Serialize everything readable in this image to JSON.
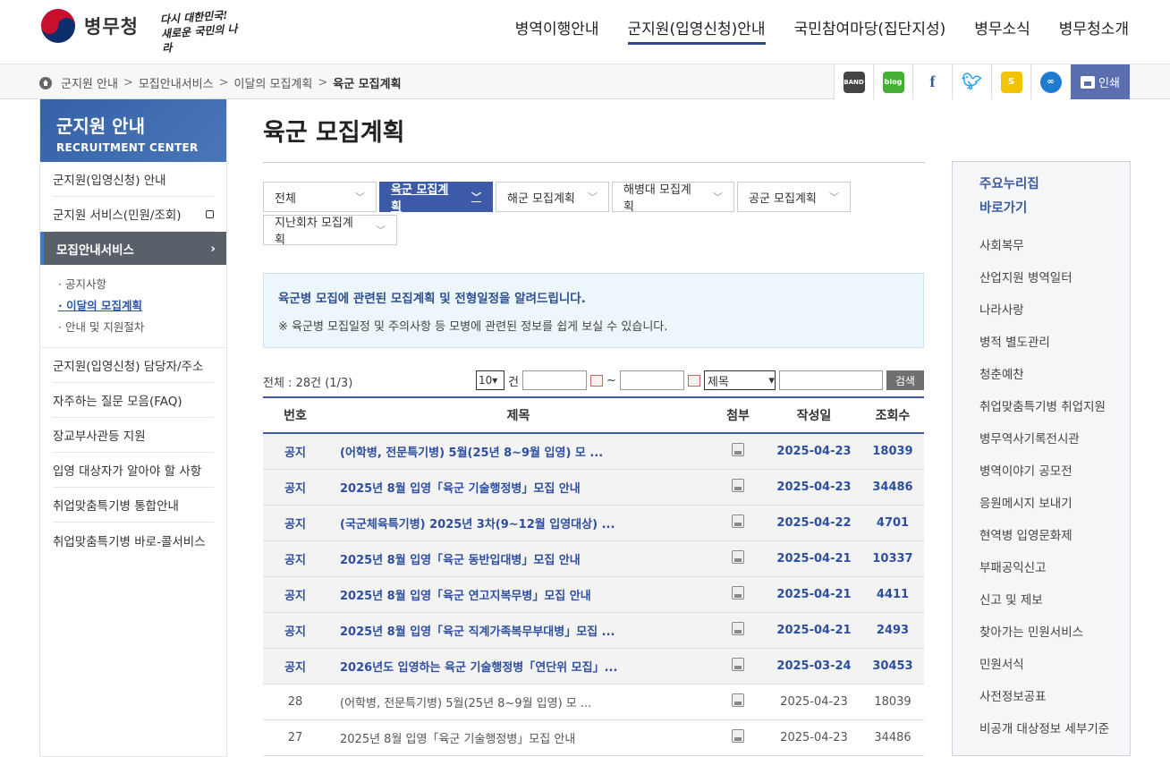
{
  "header": {
    "logo_text": "병무청",
    "slogan": "다시 대한민국! 새로운 국민의 나라",
    "nav": [
      "병역이행안내",
      "군지원(입영신청)안내",
      "국민참여마당(집단지성)",
      "병무소식",
      "병무청소개"
    ]
  },
  "breadcrumb": [
    "군지원 안내",
    "모집안내서비스",
    "이달의 모집계획",
    "육군 모집계획"
  ],
  "share": {
    "band": "BAND",
    "blog": "blog",
    "facebook": "f",
    "twitter": "t",
    "story": "S",
    "link": "∞",
    "print": "인쇄"
  },
  "lnb": {
    "title": "군지원 안내",
    "subtitle": "RECRUITMENT CENTER",
    "items_top": [
      "군지원(입영신청) 안내",
      "군지원 서비스(민원/조회)"
    ],
    "active": "모집안내서비스",
    "sub": [
      "공지사항",
      "이달의 모집계획",
      "안내 및 지원절차"
    ],
    "items_bottom": [
      "군지원(입영신청) 담당자/주소",
      "자주하는 질문 모음(FAQ)",
      "장교부사관등 지원",
      "입영 대상자가 알아야 할 사항",
      "취업맞춤특기병 통합안내",
      "취업맞춤특기병 바로-콜서비스"
    ]
  },
  "main": {
    "title": "육군 모집계획",
    "tabs": [
      "전체",
      "육군 모집계획",
      "해군 모집계획",
      "해병대 모집계획",
      "공군 모집계획",
      "지난회차 모집계획"
    ],
    "info_line1": "육군병 모집에 관련된 모집계획 및 전형일정을 알려드립니다.",
    "info_line2": "※ 육군병 모집일정 및 주의사항 등 모병에 관련된 정보를 쉽게 보실 수 있습니다.",
    "total": "전체 : 28건 (1/3)",
    "page_size": "10",
    "unit": "건",
    "tilde": "~",
    "field": "제목",
    "search_label": "검색",
    "columns": [
      "번호",
      "제목",
      "첨부",
      "작성일",
      "조회수"
    ],
    "rows": [
      {
        "no": "공지",
        "title": "(어학병, 전문특기병) 5월(25년 8~9월 입영) 모 ...",
        "date": "2025-04-23",
        "views": "18039",
        "notice": true
      },
      {
        "no": "공지",
        "title": "2025년 8월 입영「육군 기술행정병」모집 안내",
        "date": "2025-04-23",
        "views": "34486",
        "notice": true
      },
      {
        "no": "공지",
        "title": "(국군체육특기병) 2025년 3차(9~12월 입영대상) ...",
        "date": "2025-04-22",
        "views": "4701",
        "notice": true
      },
      {
        "no": "공지",
        "title": "2025년 8월 입영「육군 동반입대병」모집 안내",
        "date": "2025-04-21",
        "views": "10337",
        "notice": true
      },
      {
        "no": "공지",
        "title": "2025년 8월 입영「육군 연고지복무병」모집 안내",
        "date": "2025-04-21",
        "views": "4411",
        "notice": true
      },
      {
        "no": "공지",
        "title": "2025년 8월 입영「육군 직계가족복무부대병」모집 ...",
        "date": "2025-04-21",
        "views": "2493",
        "notice": true
      },
      {
        "no": "공지",
        "title": "2026년도 입영하는 육군 기술행정병「연단위 모집」...",
        "date": "2025-03-24",
        "views": "30453",
        "notice": true
      },
      {
        "no": "28",
        "title": "(어학병, 전문특기병) 5월(25년 8~9월 입영) 모 ...",
        "date": "2025-04-23",
        "views": "18039",
        "notice": false
      },
      {
        "no": "27",
        "title": "2025년 8월 입영「육군 기술행정병」모집 안내",
        "date": "2025-04-23",
        "views": "34486",
        "notice": false
      }
    ]
  },
  "quick": {
    "title1": "주요누리집",
    "title2": "바로가기",
    "items": [
      "사회복무",
      "산업지원 병역일터",
      "나라사랑",
      "병적 별도관리",
      "청춘예찬",
      "취업맞춤특기병 취업지원",
      "병무역사기록전시관",
      "병역이야기 공모전",
      "응원메시지 보내기",
      "현역병 입영문화제",
      "부패공익신고",
      "신고 및 제보",
      "찾아가는 민원서비스",
      "민원서식",
      "사전정보공표",
      "비공개 대상정보 세부기준"
    ]
  }
}
